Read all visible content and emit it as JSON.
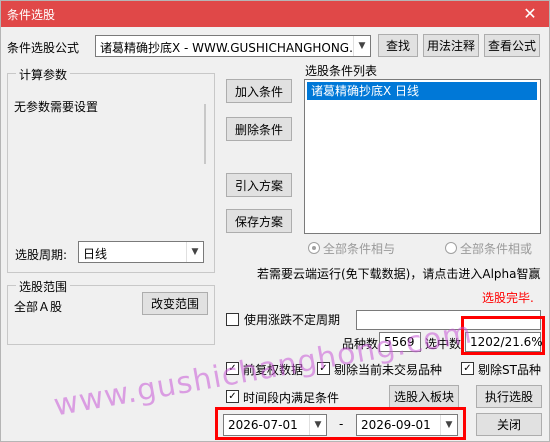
{
  "window": {
    "title": "条件选股",
    "close_glyph": "✕"
  },
  "formula": {
    "label": "条件选股公式",
    "value": "诸葛精确抄底X  -  WWW.GUSHICHANGHONG.COM",
    "find_label": "查找",
    "usage_label": "用法注释",
    "view_label": "查看公式"
  },
  "params": {
    "group_title": "计算参数",
    "text": "无参数需要设置"
  },
  "period": {
    "label": "选股周期:",
    "value": "日线"
  },
  "actions": {
    "add_condition": "加入条件",
    "delete_condition": "删除条件",
    "import_plan": "引入方案",
    "save_plan": "保存方案"
  },
  "conditions": {
    "list_title": "选股条件列表",
    "items": [
      "诸葛精确抄底X  日线"
    ]
  },
  "logic": {
    "and_label": "全部条件相与",
    "or_label": "全部条件相或"
  },
  "cloud_note": "若需要云端运行(免下载数据)，请点击进入Alpha智赢",
  "status": {
    "text": "选股完毕.",
    "color": "#ff0000"
  },
  "scope": {
    "group_title": "选股范围",
    "value": "全部Ａ股",
    "change_label": "改变范围"
  },
  "limit": {
    "label": "使用涨跌不定周期",
    "checked": false
  },
  "stats": {
    "count_label": "品种数",
    "count_value": "5569",
    "selected_label": "选中数",
    "selected_value": "1202/21.6%"
  },
  "options": {
    "adjust_label": "前复权数据",
    "exclude_untraded_label": "剔除当前未交易品种",
    "exclude_st_label": "剔除ST品种",
    "check_mark": "✓"
  },
  "time": {
    "label": "时间段内满足条件",
    "start": "2026-07-01",
    "separator": "-",
    "end": "2026-09-01"
  },
  "buttons": {
    "to_block": "选股入板块",
    "execute": "执行选股",
    "close": "关闭"
  },
  "watermark": "www.gushichanghong.com",
  "colors": {
    "titlebar": "#e04848",
    "highlight": "#ff0000",
    "selection": "#0078d7",
    "watermark": "#c85ad7"
  }
}
